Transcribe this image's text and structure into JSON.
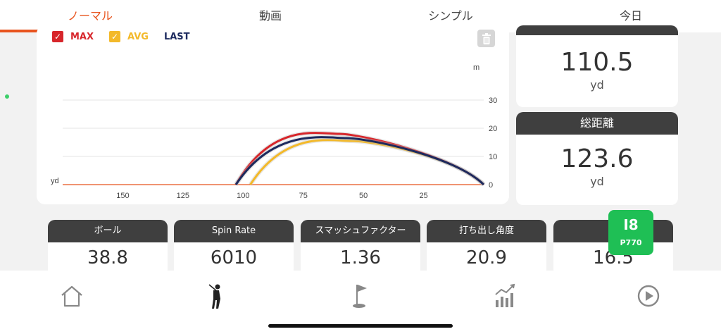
{
  "tabs": [
    {
      "label": "ノーマル",
      "active": true
    },
    {
      "label": "動画",
      "active": false
    },
    {
      "label": "シンプル",
      "active": false
    },
    {
      "label": "今日",
      "active": false
    }
  ],
  "legend": {
    "max": {
      "label": "MAX",
      "color": "#d7262b"
    },
    "avg": {
      "label": "AVG",
      "color": "#f3b92a"
    },
    "last": {
      "label": "LAST",
      "color": "#1c2a5e"
    }
  },
  "chart_data": {
    "type": "line",
    "xlabel": "yd",
    "ylabel": "m",
    "x_ticks": [
      "150",
      "125",
      "100",
      "75",
      "50",
      "25"
    ],
    "y_ticks": [
      "0",
      "10",
      "20",
      "30"
    ],
    "xlim": [
      175,
      0
    ],
    "ylim": [
      0,
      40
    ],
    "series": [
      {
        "name": "MAX",
        "color": "#d7262b",
        "x": [
          103,
          0
        ],
        "peak_x": 60,
        "peak_y": 18.0
      },
      {
        "name": "AVG",
        "color": "#f3b92a",
        "x": [
          97,
          0
        ],
        "peak_x": 55,
        "peak_y": 15.5
      },
      {
        "name": "LAST",
        "color": "#1c2a5e",
        "x": [
          103,
          0
        ],
        "peak_x": 57,
        "peak_y": 16.5
      }
    ]
  },
  "right_cards": {
    "carry_value": "110.5",
    "carry_unit": "yd",
    "total": {
      "title": "総距離",
      "value": "123.6",
      "unit": "yd"
    }
  },
  "metrics": [
    {
      "label": "ボール",
      "value": "38.8"
    },
    {
      "label": "Spin Rate",
      "value": "6010"
    },
    {
      "label": "スマッシュファクター",
      "value": "1.36"
    },
    {
      "label": "打ち出し角度",
      "value": "20.9"
    },
    {
      "label": "頂",
      "value": "16.5"
    }
  ],
  "club": {
    "number": "I8",
    "model": "P770",
    "color": "#1fbf55"
  },
  "bottom_nav": [
    "home-icon",
    "golfer-icon",
    "flag-hole-icon",
    "chart-bars-icon",
    "play-icon"
  ]
}
